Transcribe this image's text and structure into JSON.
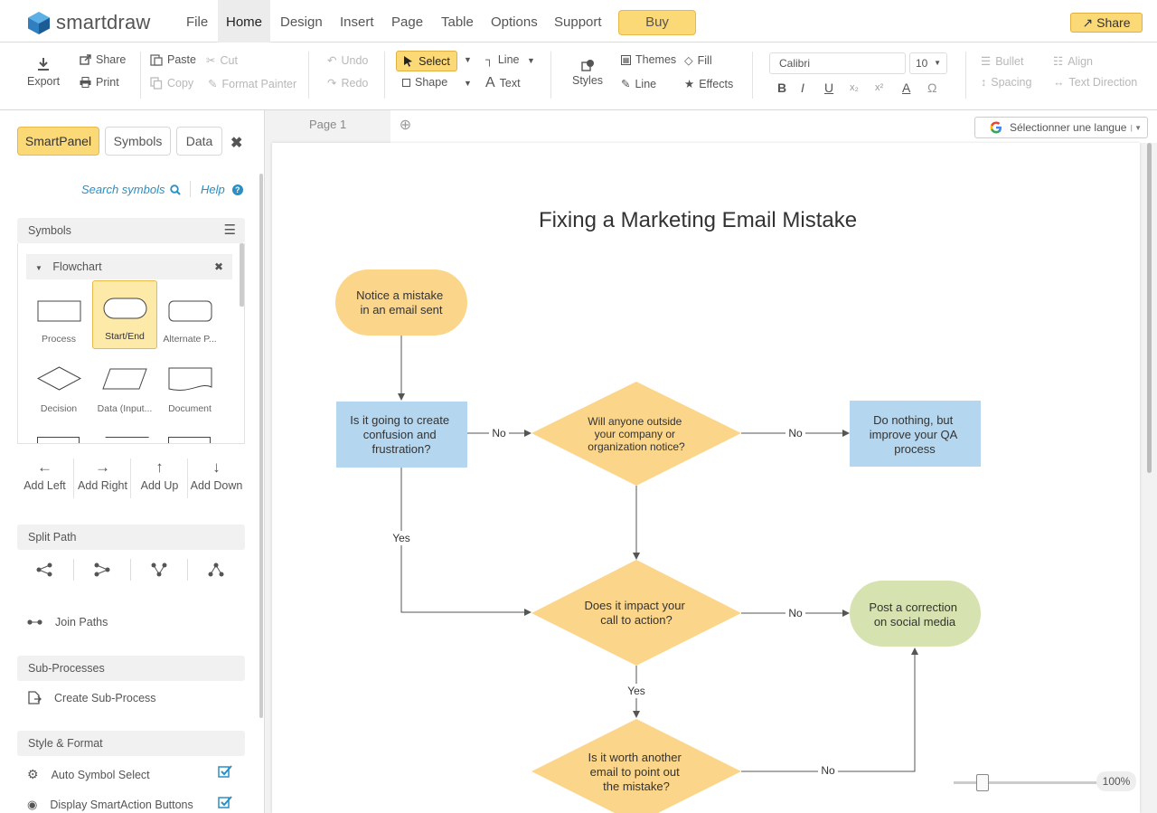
{
  "app": {
    "logo_text": "smartdraw"
  },
  "menu": {
    "items": [
      "File",
      "Home",
      "Design",
      "Insert",
      "Page",
      "Table",
      "Options",
      "Support"
    ],
    "active": "Home",
    "buy_label": "Buy",
    "share_label": "Share"
  },
  "ribbon": {
    "export": "Export",
    "share": "Share",
    "print": "Print",
    "paste": "Paste",
    "cut": "Cut",
    "copy": "Copy",
    "format_painter": "Format Painter",
    "undo": "Undo",
    "redo": "Redo",
    "select": "Select",
    "shape": "Shape",
    "line": "Line",
    "text": "Text",
    "styles": "Styles",
    "themes": "Themes",
    "fill": "Fill",
    "line2": "Line",
    "effects": "Effects",
    "font_name": "Calibri",
    "font_size": "10",
    "bullet": "Bullet",
    "align": "Align",
    "spacing": "Spacing",
    "text_direction": "Text Direction"
  },
  "panel": {
    "tabs": [
      "SmartPanel",
      "Symbols",
      "Data"
    ],
    "active_tab": "SmartPanel",
    "search_symbols": "Search symbols",
    "help": "Help",
    "symbols_header": "Symbols",
    "library": "Flowchart",
    "symbols": [
      "Process",
      "Start/End",
      "Alternate P...",
      "Decision",
      "Data (Input...",
      "Document"
    ],
    "selected_symbol": "Start/End",
    "add": [
      "Add Left",
      "Add Right",
      "Add Up",
      "Add Down"
    ],
    "split_path": "Split Path",
    "join_paths": "Join Paths",
    "sub_processes": "Sub-Processes",
    "create_sub_process": "Create Sub-Process",
    "style_format": "Style & Format",
    "auto_symbol_select": "Auto Symbol Select",
    "auto_symbol_select_checked": true,
    "display_smartaction": "Display SmartAction Buttons",
    "display_smartaction_checked": true
  },
  "canvas": {
    "page_tab": "Page 1",
    "language": "Sélectionner une langue",
    "zoom": "100%",
    "zoom_level": 0.2
  },
  "diagram": {
    "title": "Fixing a Marketing Email Mistake",
    "colors": {
      "orange": "#fbd589",
      "blue": "#b4d6ef",
      "green": "#d6e2b0",
      "line": "#555555"
    },
    "nodes": {
      "start": [
        "Notice a mistake",
        "in an email sent"
      ],
      "q1": [
        "Is it going to create",
        "confusion and",
        "frustration?"
      ],
      "q2": [
        "Will anyone outside",
        "your company or",
        "organization notice?"
      ],
      "nothing": [
        "Do nothing, but",
        "improve your QA",
        "process"
      ],
      "q3": [
        "Does it impact your",
        "call to action?"
      ],
      "post": [
        "Post a correction",
        "on social media"
      ],
      "q4": [
        "Is it worth another",
        "email to point out",
        "the mistake?"
      ]
    },
    "labels": {
      "no": "No",
      "yes": "Yes"
    }
  }
}
